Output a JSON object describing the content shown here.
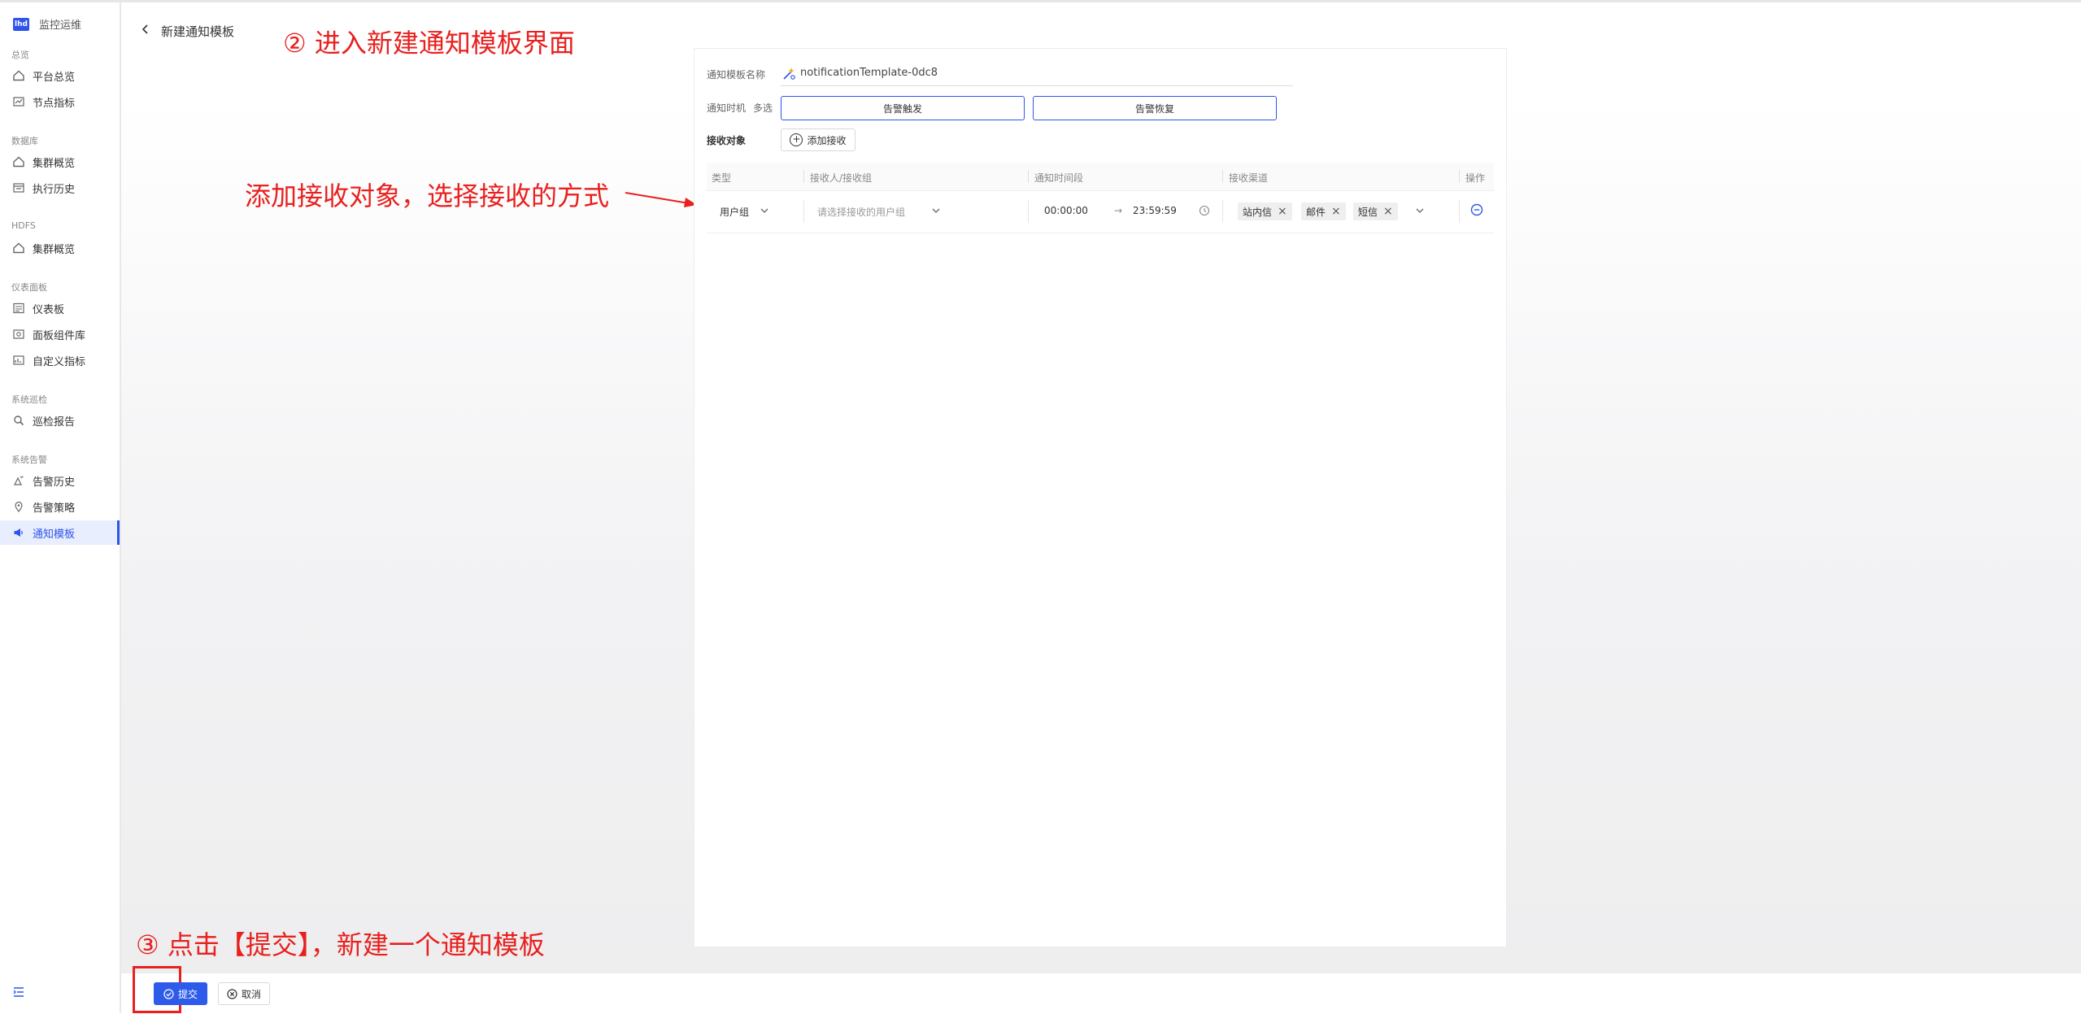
{
  "app": {
    "name": "监控运维",
    "logo_text": "lhd"
  },
  "sidebar": {
    "groups": [
      {
        "label": "总览",
        "items": [
          {
            "label": "平台总览",
            "icon": "home-icon"
          },
          {
            "label": "节点指标",
            "icon": "line-chart-icon"
          }
        ]
      },
      {
        "label": "数据库",
        "items": [
          {
            "label": "集群概览",
            "icon": "home-icon"
          },
          {
            "label": "执行历史",
            "icon": "calendar-icon"
          }
        ]
      },
      {
        "label": "HDFS",
        "items": [
          {
            "label": "集群概览",
            "icon": "home-icon"
          }
        ]
      },
      {
        "label": "仪表面板",
        "items": [
          {
            "label": "仪表板",
            "icon": "dashboard-icon"
          },
          {
            "label": "面板组件库",
            "icon": "widget-icon"
          },
          {
            "label": "自定义指标",
            "icon": "custom-metric-icon"
          }
        ]
      },
      {
        "label": "系统巡检",
        "items": [
          {
            "label": "巡检报告",
            "icon": "search-report-icon"
          }
        ]
      },
      {
        "label": "系统告警",
        "items": [
          {
            "label": "告警历史",
            "icon": "alarm-history-icon"
          },
          {
            "label": "告警策略",
            "icon": "location-icon"
          },
          {
            "label": "通知模板",
            "icon": "megaphone-icon",
            "active": true
          }
        ]
      }
    ]
  },
  "header": {
    "title": "新建通知模板"
  },
  "annotations": {
    "step2": "② 进入新建通知模板界面",
    "add_receiver": "添加接收对象，选择接收的方式",
    "step3": "③ 点击【提交】，新建一个通知模板"
  },
  "form": {
    "name_label": "通知模板名称",
    "name_value": "notificationTemplate-0dc8",
    "timing_label": "通知时机",
    "timing_hint": "多选",
    "timing_options": [
      "告警触发",
      "告警恢复"
    ],
    "receiver_label": "接收对象",
    "add_receiver_button": "添加接收"
  },
  "table": {
    "columns": [
      "类型",
      "接收人/接收组",
      "通知时间段",
      "接收渠道",
      "操作"
    ],
    "rows": [
      {
        "type": "用户组",
        "receiver_placeholder": "请选择接收的用户组",
        "time_start": "00:00:00",
        "time_arrow": "→",
        "time_end": "23:59:59",
        "channels": [
          "站内信",
          "邮件",
          "短信"
        ]
      }
    ]
  },
  "footer": {
    "submit": "提交",
    "cancel": "取消"
  },
  "colors": {
    "primary": "#2f54eb",
    "annotation": "#e8201e",
    "active_bg": "#e8eefe"
  }
}
